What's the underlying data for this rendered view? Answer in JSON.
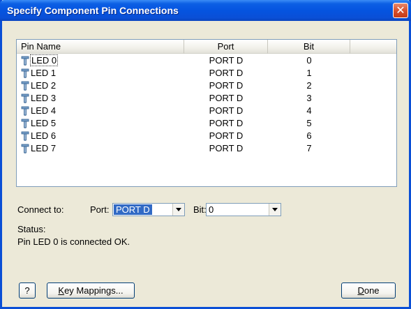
{
  "window": {
    "title": "Specify Component Pin Connections",
    "close_symbol": "✕"
  },
  "list": {
    "columns": [
      "Pin Name",
      "Port",
      "Bit",
      ""
    ],
    "rows": [
      {
        "name": "LED 0",
        "port": "PORT D",
        "bit": "0",
        "selected": true
      },
      {
        "name": "LED 1",
        "port": "PORT D",
        "bit": "1"
      },
      {
        "name": "LED 2",
        "port": "PORT D",
        "bit": "2"
      },
      {
        "name": "LED 3",
        "port": "PORT D",
        "bit": "3"
      },
      {
        "name": "LED 4",
        "port": "PORT D",
        "bit": "4"
      },
      {
        "name": "LED 5",
        "port": "PORT D",
        "bit": "5"
      },
      {
        "name": "LED 6",
        "port": "PORT D",
        "bit": "6"
      },
      {
        "name": "LED 7",
        "port": "PORT D",
        "bit": "7"
      }
    ],
    "row_icon": "pin-icon"
  },
  "connect": {
    "label": "Connect to:",
    "port_label": "Port:",
    "port_value": "PORT D",
    "bit_label": "Bit:",
    "bit_value": "0"
  },
  "status": {
    "label": "Status:",
    "message": "Pin LED 0 is connected OK."
  },
  "buttons": {
    "help": "?",
    "key_mappings_prefix": "K",
    "key_mappings_rest": "ey Mappings...",
    "done_prefix": "D",
    "done_rest": "one"
  },
  "colors": {
    "title_blue": "#0554e0",
    "selection_blue": "#316ac5",
    "dialog_bg": "#ece9d8"
  }
}
